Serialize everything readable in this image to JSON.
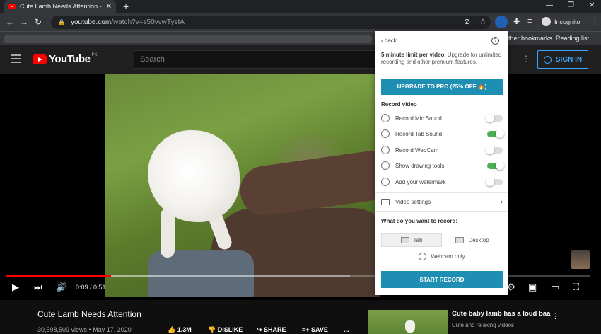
{
  "browser": {
    "tab_title": "Cute Lamb Needs Attention - Yo",
    "tab_close": "✕",
    "new_tab": "+",
    "url_host": "youtube.com",
    "url_path": "/watch?v=s50vvwTystA",
    "profile_label": "Incognito",
    "bookmarks_other": "Other bookmarks",
    "reading_list": "Reading list"
  },
  "youtube": {
    "logo_text": "YouTube",
    "region": "PK",
    "search_placeholder": "Search",
    "sign_in": "SIGN IN",
    "time": "0:09 / 0:51",
    "progress_played": 0.18,
    "video_title": "Cute Lamb Needs Attention",
    "views_date": "30,598,509 views • May 17, 2020",
    "likes": "1.3M",
    "dislike": "DISLIKE",
    "share": "SHARE",
    "save": "SAVE",
    "more": "...",
    "related_title": "Cute baby lamb has a loud baa",
    "related_channel": "Cute and relaxing videos"
  },
  "popup": {
    "back": "back",
    "help": "?",
    "limit_bold": "5 minute limit per video.",
    "limit_rest": " Upgrade for unlimited recording and other premium features.",
    "upgrade_button": "UPGRADE TO PRO (25% OFF 🔥)",
    "record_video_heading": "Record video",
    "options": [
      {
        "label": "Record Mic Sound",
        "icon": "mic-icon",
        "on": false
      },
      {
        "label": "Record Tab Sound",
        "icon": "speaker-icon",
        "on": true
      },
      {
        "label": "Record WebCam",
        "icon": "webcam-icon",
        "on": false
      },
      {
        "label": "Show drawing tools",
        "icon": "palette-icon",
        "on": true
      },
      {
        "label": "Add your watermark",
        "icon": "watermark-icon",
        "on": false
      }
    ],
    "video_settings": "Video settings",
    "what_record_heading": "What do you want to record:",
    "mode_tab": "Tab",
    "mode_desktop": "Desktop",
    "webcam_only": "Webcam only",
    "start_record": "START RECORD"
  },
  "colors": {
    "accent": "#1e8fb3",
    "toggle_on": "#4caf50",
    "yt_red": "#ff0000"
  }
}
